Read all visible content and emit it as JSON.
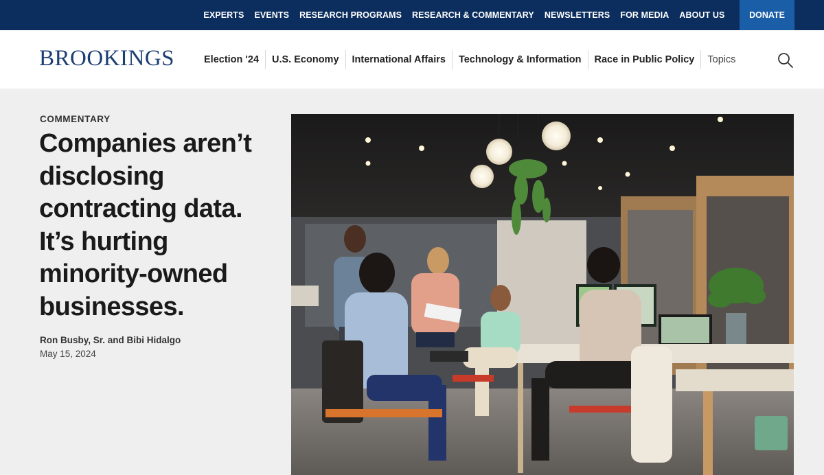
{
  "topbar": {
    "links": [
      "EXPERTS",
      "EVENTS",
      "RESEARCH PROGRAMS",
      "RESEARCH & COMMENTARY",
      "NEWSLETTERS",
      "FOR MEDIA",
      "ABOUT US"
    ],
    "donate_label": "DONATE"
  },
  "header": {
    "logo": "BROOKINGS",
    "nav": [
      "Election '24",
      "U.S. Economy",
      "International Affairs",
      "Technology & Information",
      "Race in Public Policy",
      "Topics"
    ]
  },
  "article": {
    "kicker": "COMMENTARY",
    "headline": "Companies aren’t disclosing contracting data. It’s hurting minority-owned businesses.",
    "authors": "Ron Busby, Sr. and Bibi Hidalgo",
    "date": "May 15, 2024"
  },
  "colors": {
    "topbar": "#0b2e5e",
    "donate": "#1a5ea8",
    "logo": "#1c3f73"
  }
}
